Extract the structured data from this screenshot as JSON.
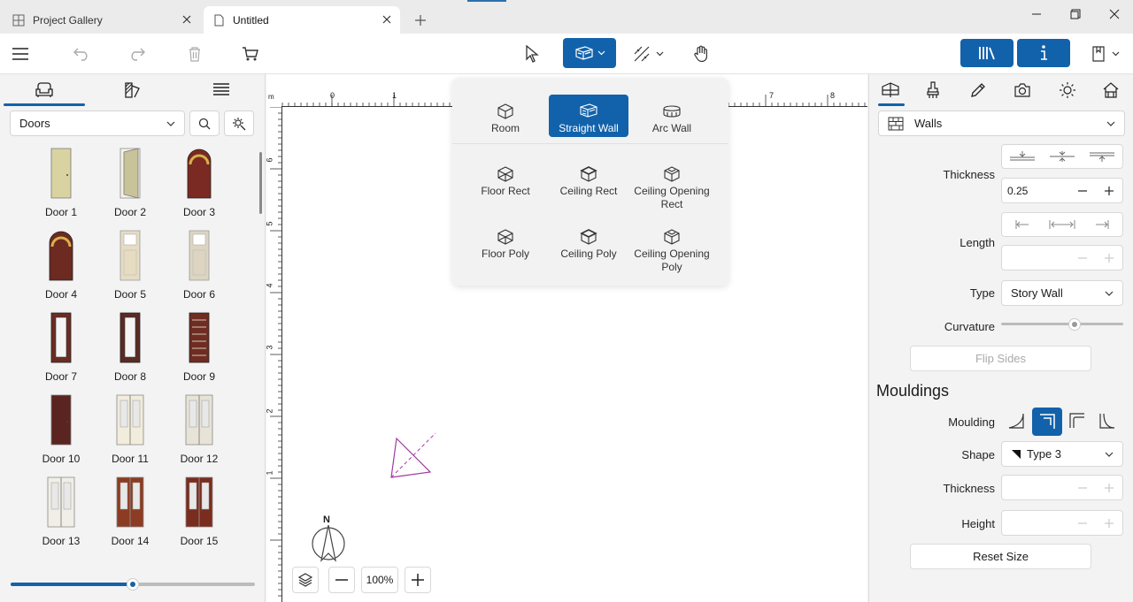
{
  "tabs": [
    {
      "label": "Project Gallery"
    },
    {
      "label": "Untitled"
    }
  ],
  "toolbar": {
    "zoom": "100%"
  },
  "left": {
    "category": "Doors",
    "items": [
      {
        "label": "Door 1",
        "color": "#d8d3a0",
        "style": "plain"
      },
      {
        "label": "Door 2",
        "color": "#c9c39a",
        "style": "open"
      },
      {
        "label": "Door 3",
        "color": "#7a2a22",
        "style": "arch"
      },
      {
        "label": "Door 4",
        "color": "#6d2a20",
        "style": "arch"
      },
      {
        "label": "Door 5",
        "color": "#e6dcc2",
        "style": "panel"
      },
      {
        "label": "Door 6",
        "color": "#ddd5c1",
        "style": "panel"
      },
      {
        "label": "Door 7",
        "color": "#6b2c22",
        "style": "glass"
      },
      {
        "label": "Door 8",
        "color": "#5a2b24",
        "style": "glass"
      },
      {
        "label": "Door 9",
        "color": "#6e2c22",
        "style": "slat"
      },
      {
        "label": "Door 10",
        "color": "#5a2420",
        "style": "plain"
      },
      {
        "label": "Door 11",
        "color": "#f1ecdb",
        "style": "double"
      },
      {
        "label": "Door 12",
        "color": "#e7e3d6",
        "style": "double"
      },
      {
        "label": "Door 13",
        "color": "#f0eee6",
        "style": "double"
      },
      {
        "label": "Door 14",
        "color": "#8c3c22",
        "style": "double"
      },
      {
        "label": "Door 15",
        "color": "#7a2c1e",
        "style": "double"
      },
      {
        "label": "",
        "color": "#8c3c22",
        "style": "plain"
      },
      {
        "label": "",
        "color": "#efe6cc",
        "style": "plain"
      },
      {
        "label": "",
        "color": "#e4e0d2",
        "style": "plain"
      }
    ]
  },
  "ruler": {
    "h": [
      {
        "t": "m"
      },
      {
        "t": "0"
      },
      {
        "t": "1"
      },
      {
        "t": "7"
      },
      {
        "t": "8"
      }
    ],
    "v": [
      {
        "t": "6"
      },
      {
        "t": "5"
      },
      {
        "t": "4"
      },
      {
        "t": "3"
      },
      {
        "t": "2"
      },
      {
        "t": "1"
      }
    ]
  },
  "compass": "N",
  "popup": {
    "items": [
      {
        "label": "Room",
        "selected": false
      },
      {
        "label": "Straight Wall",
        "selected": true
      },
      {
        "label": "Arc Wall",
        "selected": false
      },
      {
        "label": "Floor Rect",
        "selected": false
      },
      {
        "label": "Ceiling Rect",
        "selected": false
      },
      {
        "label": "Ceiling Opening Rect",
        "selected": false
      },
      {
        "label": "Floor Poly",
        "selected": false
      },
      {
        "label": "Ceiling Poly",
        "selected": false
      },
      {
        "label": "Ceiling Opening Poly",
        "selected": false
      }
    ]
  },
  "right": {
    "select": "Walls",
    "thickness_label": "Thickness",
    "thickness_value": "0.25",
    "length_label": "Length",
    "type_label": "Type",
    "type_value": "Story Wall",
    "curvature_label": "Curvature",
    "curvature": 0.6,
    "flip_sides": "Flip Sides",
    "mouldings_title": "Mouldings",
    "moulding_label": "Moulding",
    "shape_label": "Shape",
    "shape_value": "Type 3",
    "m_thickness_label": "Thickness",
    "height_label": "Height",
    "reset_size": "Reset Size"
  },
  "accent": "#1262ab"
}
